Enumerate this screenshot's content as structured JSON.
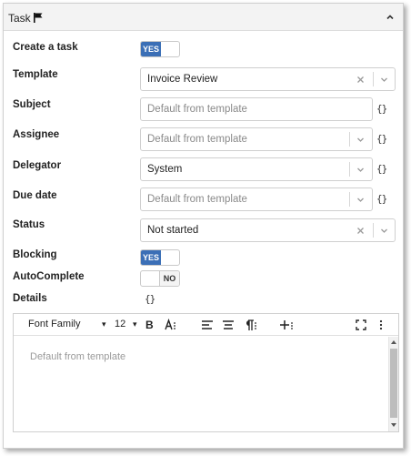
{
  "panel": {
    "title": "Task"
  },
  "labels": {
    "create_task": "Create a task",
    "template": "Template",
    "subject": "Subject",
    "assignee": "Assignee",
    "delegator": "Delegator",
    "due_date": "Due date",
    "status": "Status",
    "blocking": "Blocking",
    "autocomplete": "AutoComplete",
    "details": "Details"
  },
  "toggles": {
    "create_task": {
      "state": "YES"
    },
    "blocking": {
      "state": "YES"
    },
    "autocomplete": {
      "state": "NO"
    }
  },
  "fields": {
    "template": {
      "value": "Invoice Review"
    },
    "subject": {
      "placeholder": "Default from template"
    },
    "assignee": {
      "placeholder": "Default from template"
    },
    "delegator": {
      "value": "System"
    },
    "due_date": {
      "placeholder": "Default from template"
    },
    "status": {
      "value": "Not started"
    }
  },
  "expression_button": "{}",
  "editor": {
    "font_family": "Font Family",
    "font_size": "12",
    "placeholder": "Default from template"
  },
  "colors": {
    "accent": "#3b6fb6"
  },
  "icons": [
    "flag-icon",
    "chevron-up-icon",
    "clear-icon",
    "chevron-down-icon",
    "bold-icon",
    "text-size-icon",
    "align-left-icon",
    "align-center-icon",
    "paragraph-icon",
    "insert-icon",
    "fullscreen-icon",
    "more-icon"
  ]
}
